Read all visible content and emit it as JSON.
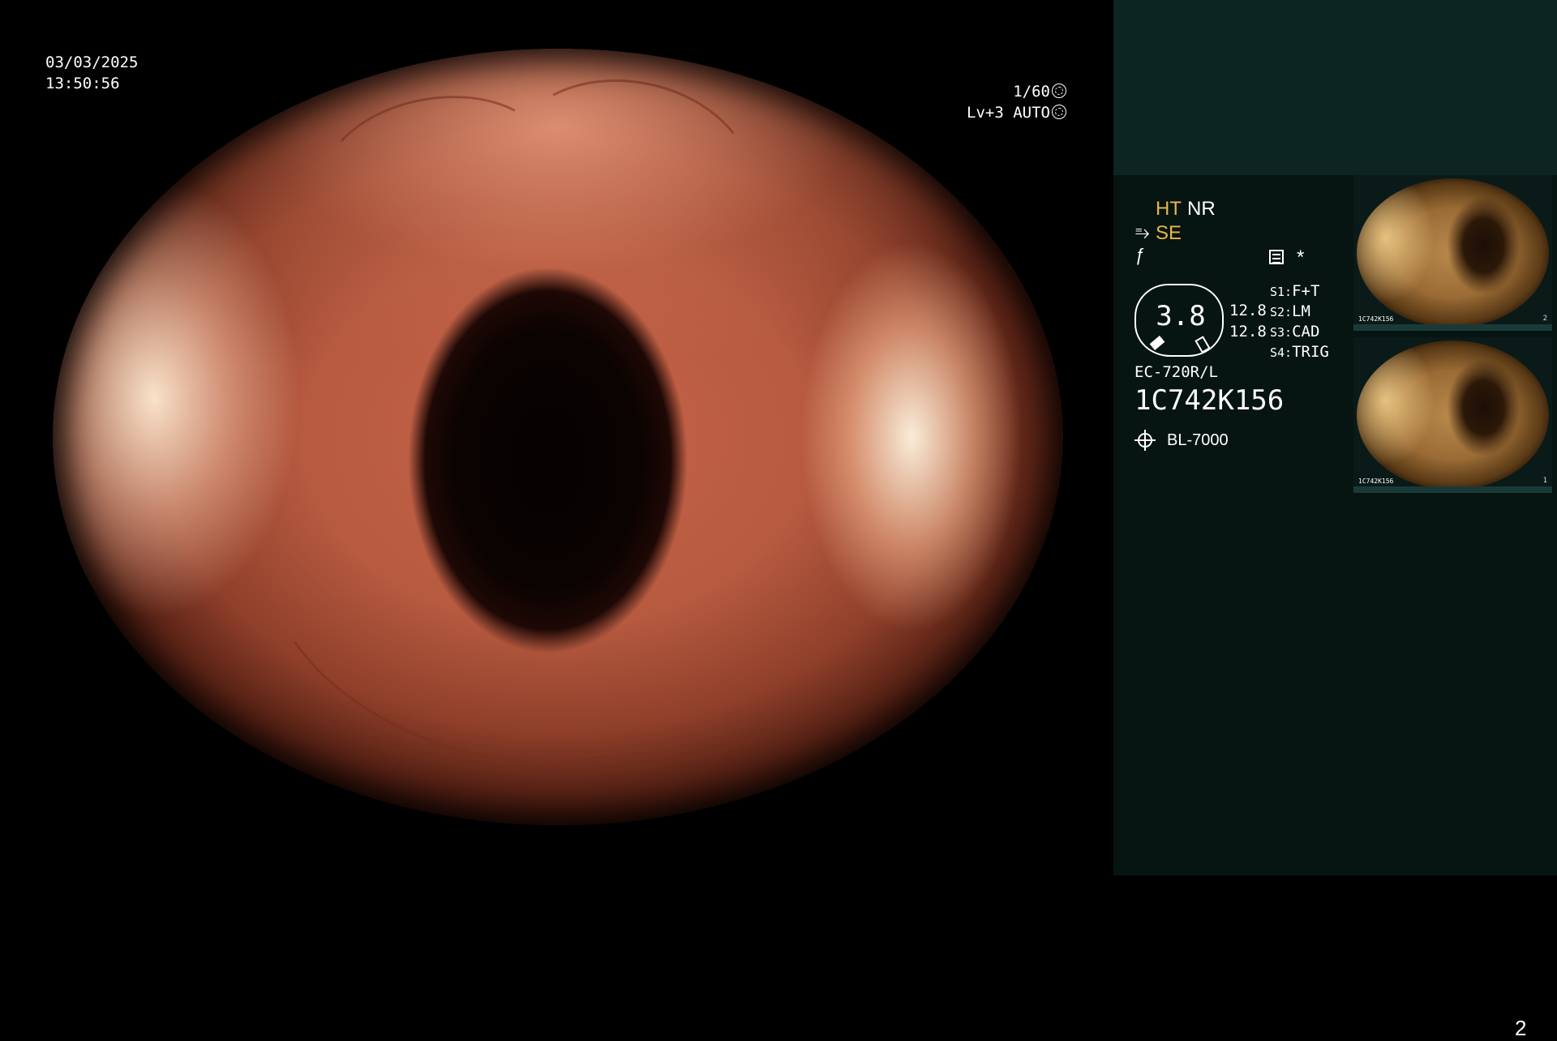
{
  "overlay": {
    "date": "03/03/2025",
    "time": "13:50:56",
    "shutter": "1/60",
    "level": "Lv+3",
    "exposure": "AUTO",
    "shutter_icon": "shutter-icon",
    "auto_icon": "iris-icon"
  },
  "panel": {
    "ht": "HT",
    "nr": "NR",
    "se": "SE",
    "se_symbol": "⥱",
    "f_symbol": "ƒ",
    "asterisk": "*",
    "zoom": "3.8",
    "value_1": "12.8",
    "value_2": "12.8",
    "switches": [
      {
        "key": "S1:",
        "value": "F+T"
      },
      {
        "key": "S2:",
        "value": "LM"
      },
      {
        "key": "S3:",
        "value": "CAD"
      },
      {
        "key": "S4:",
        "value": "TRIG"
      }
    ],
    "scope_model": "EC-720R/L",
    "serial": "1C742K156",
    "light_source": "BL-7000",
    "page_number": "2",
    "colors": {
      "accent": "#e8b54a",
      "panel_top": "#0c2523",
      "panel_bg": "#061412"
    }
  },
  "thumbnails": [
    {
      "index": "2",
      "serial": "1C742K156"
    },
    {
      "index": "1",
      "serial": "1C742K156"
    }
  ]
}
